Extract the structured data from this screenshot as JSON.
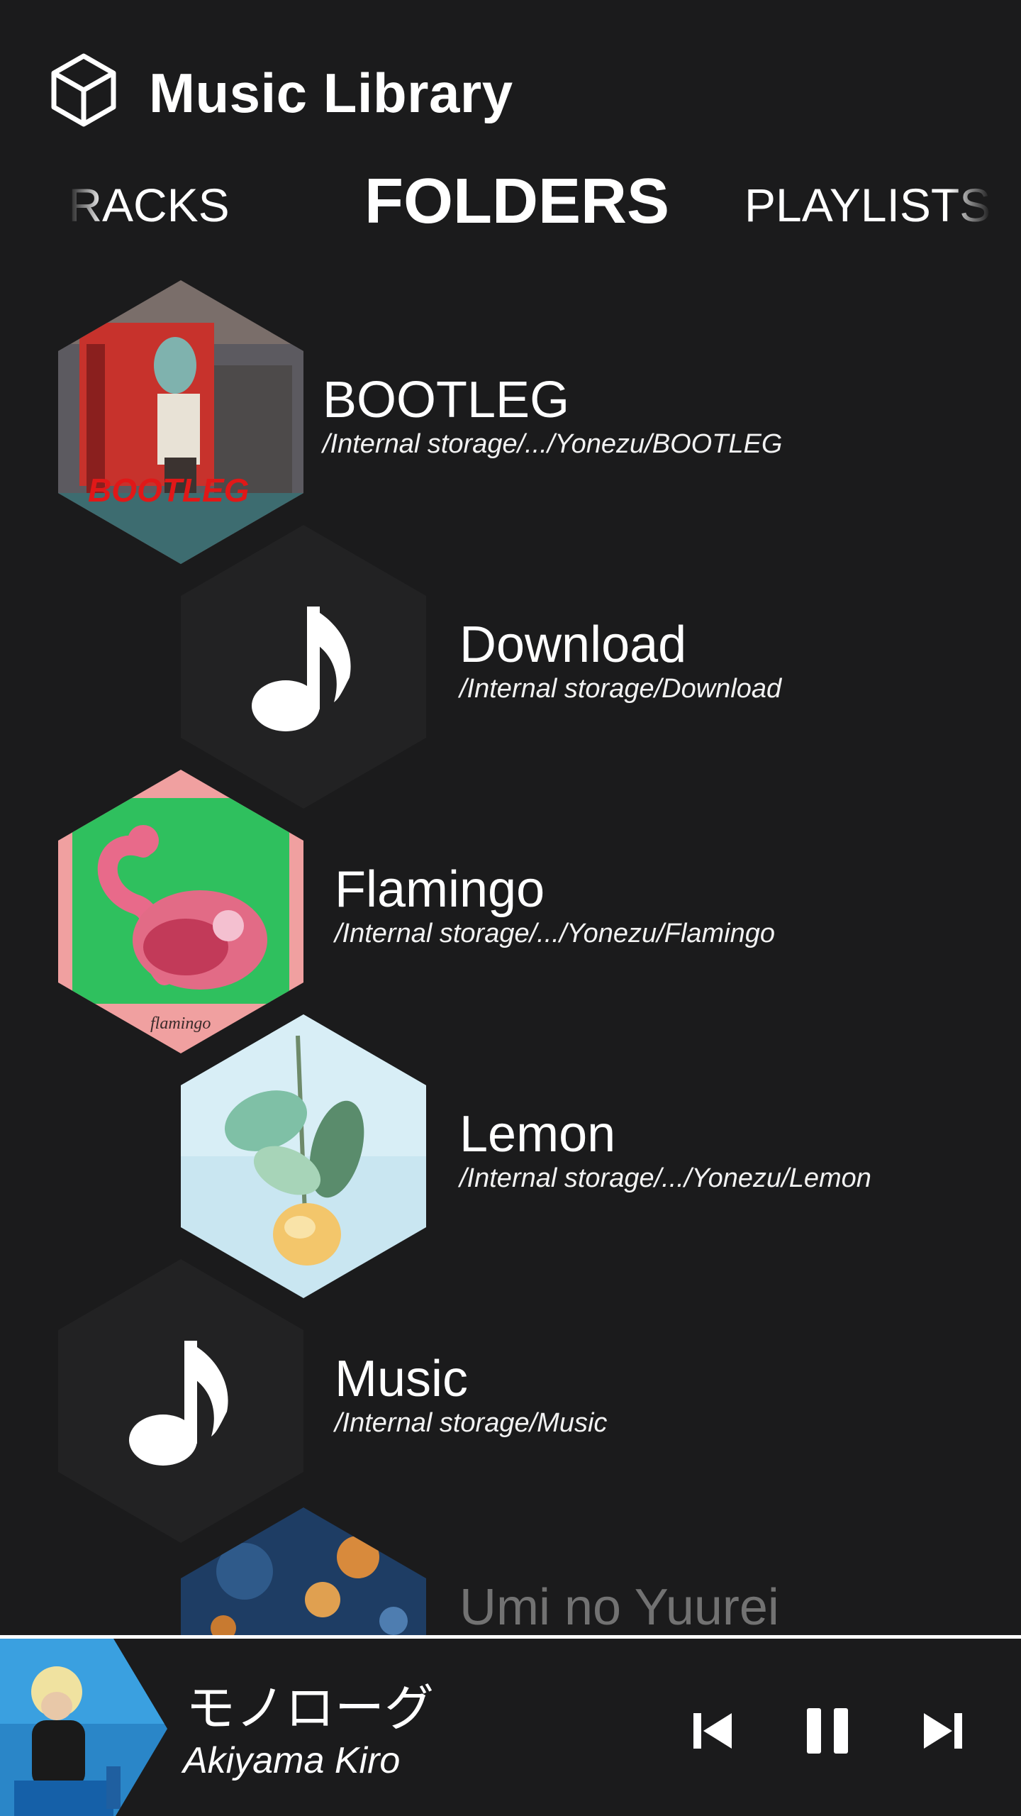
{
  "header": {
    "title": "Music Library",
    "logo_icon": "hexagon-cube-logo-icon"
  },
  "tabs": [
    {
      "label": "TRACKS",
      "state": "partial-left"
    },
    {
      "label": "FOLDERS",
      "state": "active"
    },
    {
      "label": "PLAYLISTS",
      "state": "partial-right"
    }
  ],
  "folders": [
    {
      "name": "BOOTLEG",
      "path": "/Internal storage/.../Yonezu/BOOTLEG",
      "art": "album-art"
    },
    {
      "name": "Download",
      "path": "/Internal storage/Download",
      "art": "music-note-icon"
    },
    {
      "name": "Flamingo",
      "path": "/Internal storage/.../Yonezu/Flamingo",
      "art": "album-art"
    },
    {
      "name": "Lemon",
      "path": "/Internal storage/.../Yonezu/Lemon",
      "art": "album-art"
    },
    {
      "name": "Music",
      "path": "/Internal storage/Music",
      "art": "music-note-icon"
    },
    {
      "name": "Umi no Yuurei",
      "path": "",
      "art": "album-art"
    }
  ],
  "player": {
    "title": "モノローグ",
    "artist": "Akiyama Kiro",
    "controls": [
      "previous-icon",
      "pause-icon",
      "next-icon"
    ]
  },
  "colors": {
    "background": "#1b1b1c",
    "hex_empty": "#222223",
    "text": "#ffffff"
  }
}
